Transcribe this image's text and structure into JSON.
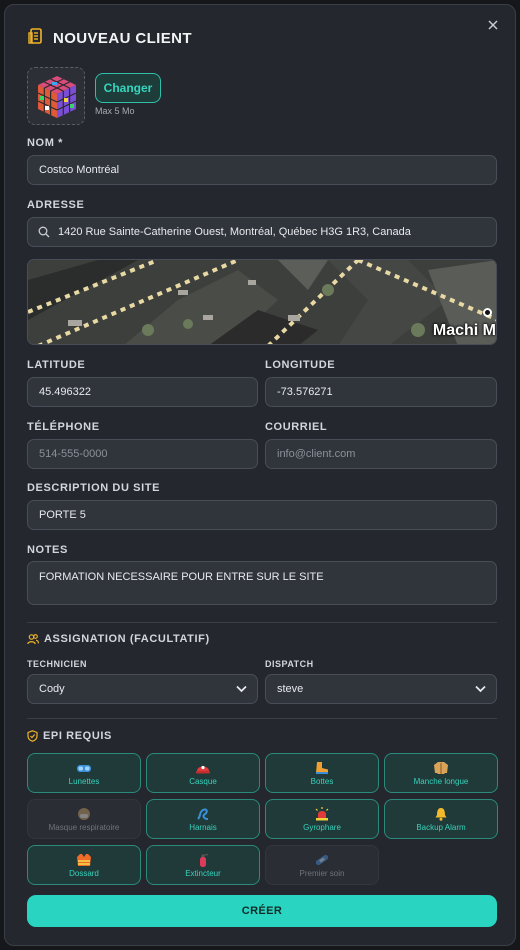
{
  "modal": {
    "title": "NOUVEAU CLIENT"
  },
  "logo": {
    "change_label": "Changer",
    "max_size": "Max 5 Mo"
  },
  "form": {
    "name": {
      "label": "NOM *",
      "value": "Costco Montréal"
    },
    "address": {
      "label": "ADRESSE",
      "value": "1420 Rue Sainte-Catherine Ouest, Montréal, Québec H3G 1R3, Canada"
    },
    "map_label": "Machi M",
    "latitude": {
      "label": "LATITUDE",
      "value": "45.496322"
    },
    "longitude": {
      "label": "LONGITUDE",
      "value": "-73.576271"
    },
    "phone": {
      "label": "TÉLÉPHONE",
      "placeholder": "514-555-0000"
    },
    "email": {
      "label": "COURRIEL",
      "placeholder": "info@client.com"
    },
    "site_description": {
      "label": "DESCRIPTION DU SITE",
      "value": "PORTE 5"
    },
    "notes": {
      "label": "NOTES",
      "value": "FORMATION NECESSAIRE POUR ENTRE SUR LE SITE"
    }
  },
  "assignment": {
    "title": "ASSIGNATION (FACULTATIF)",
    "technician": {
      "label": "TECHNICIEN",
      "value": "Cody"
    },
    "dispatch": {
      "label": "DISPATCH",
      "value": "steve"
    }
  },
  "epi": {
    "title": "EPI REQUIS",
    "items": [
      {
        "label": "Lunettes",
        "icon": "goggles-icon",
        "selected": true
      },
      {
        "label": "Casque",
        "icon": "helmet-icon",
        "selected": true
      },
      {
        "label": "Bottes",
        "icon": "boot-icon",
        "selected": true
      },
      {
        "label": "Manche longue",
        "icon": "coat-icon",
        "selected": true
      },
      {
        "label": "Masque respiratoire",
        "icon": "mask-icon",
        "selected": false
      },
      {
        "label": "Harnais",
        "icon": "harness-icon",
        "selected": true
      },
      {
        "label": "Gyrophare",
        "icon": "beacon-icon",
        "selected": true
      },
      {
        "label": "Backup Alarm",
        "icon": "bell-icon",
        "selected": true
      },
      {
        "label": "Dossard",
        "icon": "vest-icon",
        "selected": true
      },
      {
        "label": "Extincteur",
        "icon": "extinguisher-icon",
        "selected": true
      },
      {
        "label": "Premier soin",
        "icon": "bandage-icon",
        "selected": false
      }
    ]
  },
  "submit_label": "CRÉER",
  "colors": {
    "accent": "#29d5c1",
    "background": "#24272d",
    "field": "#30343b"
  }
}
